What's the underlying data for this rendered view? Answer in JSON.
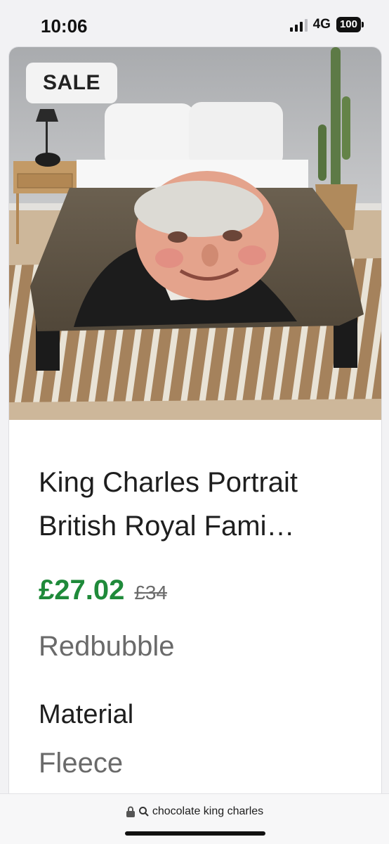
{
  "status_bar": {
    "time": "10:06",
    "network": "4G",
    "battery": "100"
  },
  "product": {
    "badge": "SALE",
    "title_line1": "King Charles Portrait",
    "title_line2": "British Royal Fami…",
    "price_current": "£27.02",
    "price_old": "£34",
    "seller": "Redbubble",
    "attribute_label": "Material",
    "attribute_value": "Fleece",
    "image_alt": "Fleece blanket with King Charles portrait on a bed"
  },
  "url_bar": {
    "query": "chocolate king charles",
    "lock_icon": "lock-icon",
    "search_icon": "search-icon"
  },
  "colors": {
    "price_green": "#1f8a3a",
    "secondary_text": "#6a6a6a"
  }
}
